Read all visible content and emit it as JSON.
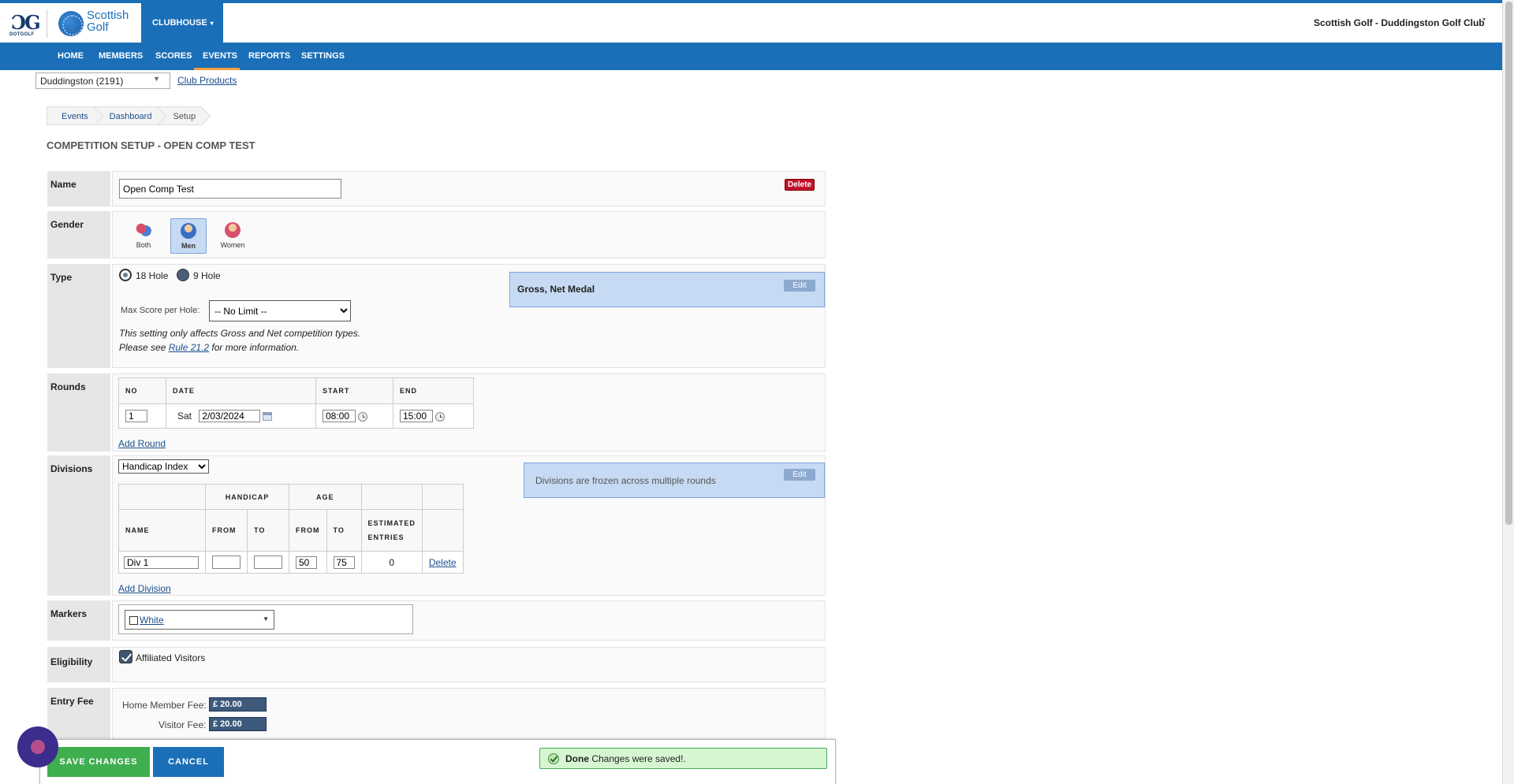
{
  "header": {
    "dotgolf_text": "DOTGOLF",
    "brand_line1": "Scottish",
    "brand_line2": "Golf",
    "clubhouse_label": "CLUBHOUSE",
    "club_name": "Scottish Golf - Duddingston Golf Club"
  },
  "nav": {
    "items": [
      "HOME",
      "MEMBERS",
      "SCORES",
      "EVENTS",
      "REPORTS",
      "SETTINGS"
    ],
    "active": "EVENTS"
  },
  "club_selector": {
    "value": "Duddingston (2191)",
    "products_link": "Club Products"
  },
  "breadcrumb": [
    "Events",
    "Dashboard",
    "Setup"
  ],
  "page_title": "COMPETITION SETUP - OPEN COMP TEST",
  "labels": {
    "name": "Name",
    "gender": "Gender",
    "type": "Type",
    "rounds": "Rounds",
    "divisions": "Divisions",
    "markers": "Markers",
    "eligibility": "Eligibility",
    "entry_fee": "Entry Fee"
  },
  "name_section": {
    "value": "Open Comp Test",
    "delete_label": "Delete"
  },
  "gender_section": {
    "options": [
      "Both",
      "Men",
      "Women"
    ],
    "selected": "Men"
  },
  "type_section": {
    "hole_options": [
      "18 Hole",
      "9 Hole"
    ],
    "selected": "18 Hole",
    "max_score_label": "Max Score per Hole:",
    "max_score_value": "-- No Limit --",
    "note_line1": "This setting only affects Gross and Net competition types.",
    "note_line2_prefix": "Please see ",
    "note_link": "Rule 21.2",
    "note_line2_suffix": " for more information.",
    "comp_type": "Gross, Net Medal",
    "edit_label": "Edit"
  },
  "rounds_section": {
    "headers": [
      "NO",
      "DATE",
      "START",
      "END"
    ],
    "rows": [
      {
        "no": "1",
        "day": "Sat",
        "date": "2/03/2024",
        "start": "08:00",
        "end": "15:00"
      }
    ],
    "add_label": "Add Round"
  },
  "divisions_section": {
    "basis_value": "Handicap Index",
    "group_headers": [
      "HANDICAP",
      "AGE"
    ],
    "headers": [
      "NAME",
      "FROM",
      "TO",
      "FROM",
      "TO",
      "ESTIMATED ENTRIES"
    ],
    "rows": [
      {
        "name": "Div 1",
        "hcp_from": "",
        "hcp_to": "",
        "age_from": "50",
        "age_to": "75",
        "entries": "0",
        "delete_label": "Delete"
      }
    ],
    "add_label": "Add Division",
    "frozen_note": "Divisions are frozen across multiple rounds",
    "edit_label": "Edit"
  },
  "markers_section": {
    "value": "White"
  },
  "eligibility_section": {
    "option": "Affiliated Visitors",
    "checked": true
  },
  "entry_fee_section": {
    "home_label": "Home Member Fee:",
    "home_value": "£ 20.00",
    "visitor_label": "Visitor Fee:",
    "visitor_value": "£ 20.00"
  },
  "footer": {
    "save_label": "SAVE CHANGES",
    "cancel_label": "CANCEL",
    "toast_title": "Done",
    "toast_message": "Changes were saved!."
  },
  "colors": {
    "brand_blue": "#1a6fb8",
    "save_green": "#3fae4f",
    "delete_red": "#c0112b",
    "info_blue": "#c7daf4"
  }
}
